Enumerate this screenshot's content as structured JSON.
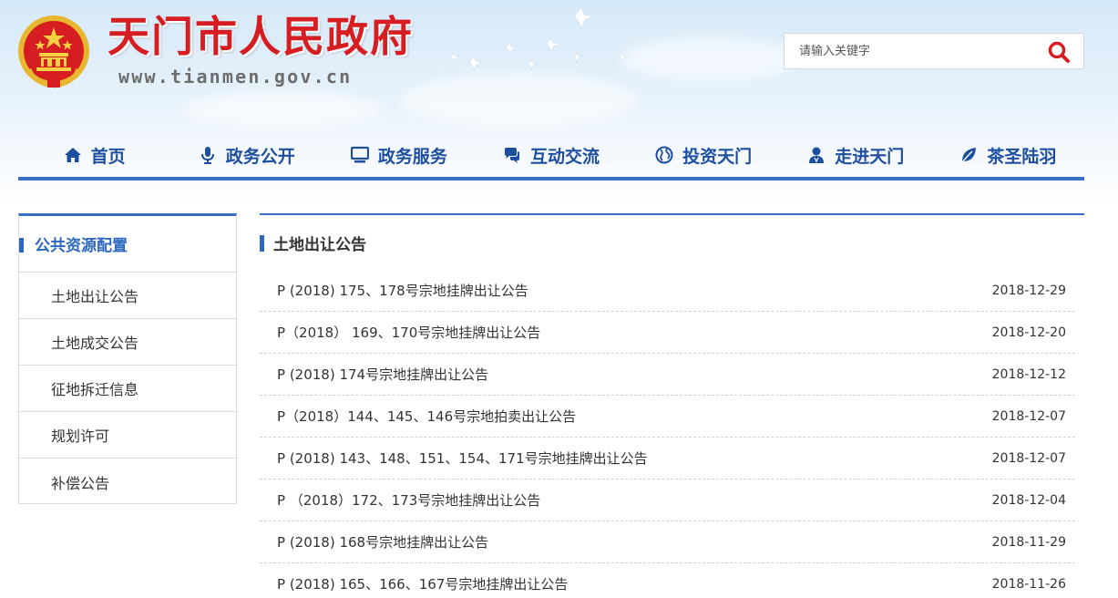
{
  "header": {
    "site_title": "天门市人民政府",
    "site_url": "www.tianmen.gov.cn",
    "search_placeholder": "请输入关键字"
  },
  "nav": {
    "items": [
      {
        "label": "首页",
        "icon": "home-icon"
      },
      {
        "label": "政务公开",
        "icon": "microphone-icon"
      },
      {
        "label": "政务服务",
        "icon": "monitor-icon"
      },
      {
        "label": "互动交流",
        "icon": "chat-icon"
      },
      {
        "label": "投资天门",
        "icon": "globe-icon"
      },
      {
        "label": "走进天门",
        "icon": "person-icon"
      },
      {
        "label": "茶圣陆羽",
        "icon": "leaf-icon"
      }
    ]
  },
  "sidebar": {
    "title": "公共资源配置",
    "items": [
      {
        "label": "土地出让公告"
      },
      {
        "label": "土地成交公告"
      },
      {
        "label": "征地拆迁信息"
      },
      {
        "label": "规划许可"
      },
      {
        "label": "补偿公告"
      }
    ]
  },
  "main": {
    "title": "土地出让公告",
    "articles": [
      {
        "title": "P (2018) 175、178号宗地挂牌出让公告",
        "date": "2018-12-29"
      },
      {
        "title": "P（2018） 169、170号宗地挂牌出让公告",
        "date": "2018-12-20"
      },
      {
        "title": "P (2018) 174号宗地挂牌出让公告",
        "date": "2018-12-12"
      },
      {
        "title": "P（2018）144、145、146号宗地拍卖出让公告",
        "date": "2018-12-07"
      },
      {
        "title": "P (2018) 143、148、151、154、171号宗地挂牌出让公告",
        "date": "2018-12-07"
      },
      {
        "title": "P （2018）172、173号宗地挂牌出让公告",
        "date": "2018-12-04"
      },
      {
        "title": "P (2018) 168号宗地挂牌出让公告",
        "date": "2018-11-29"
      },
      {
        "title": "P (2018) 165、166、167号宗地挂牌出让公告",
        "date": "2018-11-26"
      }
    ]
  },
  "colors": {
    "brand_red": "#d51d22",
    "nav_blue": "#1d4f9e",
    "accent_blue": "#3a6fc7"
  }
}
